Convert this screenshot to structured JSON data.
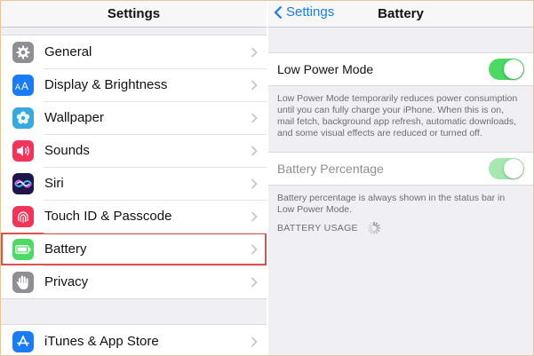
{
  "left_nav": {
    "title": "Settings"
  },
  "settings_items": [
    {
      "label": "General",
      "icon": "gear-icon",
      "color": "#8e8e93"
    },
    {
      "label": "Display & Brightness",
      "icon": "text-size-icon",
      "color": "#1a7cf5"
    },
    {
      "label": "Wallpaper",
      "icon": "flower-icon",
      "color": "#36aadc"
    },
    {
      "label": "Sounds",
      "icon": "speaker-icon",
      "color": "#f2345a"
    },
    {
      "label": "Siri",
      "icon": "siri-icon",
      "color": "#20164a"
    },
    {
      "label": "Touch ID & Passcode",
      "icon": "fingerprint-icon",
      "color": "#f2345a"
    },
    {
      "label": "Battery",
      "icon": "battery-icon",
      "color": "#4cd964",
      "selected": true
    },
    {
      "label": "Privacy",
      "icon": "hand-icon",
      "color": "#8e8e93"
    }
  ],
  "settings_items_2": [
    {
      "label": "iTunes & App Store",
      "icon": "app-store-icon",
      "color": "#1a7cf5"
    }
  ],
  "right_nav": {
    "back_label": "Settings",
    "title": "Battery"
  },
  "battery": {
    "low_power": {
      "label": "Low Power Mode",
      "on": true
    },
    "low_power_desc": "Low Power Mode temporarily reduces power consumption until you can fully charge your iPhone. When this is on, mail fetch, background app refresh, automatic downloads, and some visual effects are reduced or turned off.",
    "percentage": {
      "label": "Battery Percentage",
      "on": true,
      "disabled": true
    },
    "percentage_desc": "Battery percentage is always shown in the status bar in Low Power Mode.",
    "usage_header": "BATTERY USAGE"
  },
  "colors": {
    "accent": "#1a7cf5",
    "switch_on": "#4cd964",
    "selection": "#d9534f"
  }
}
